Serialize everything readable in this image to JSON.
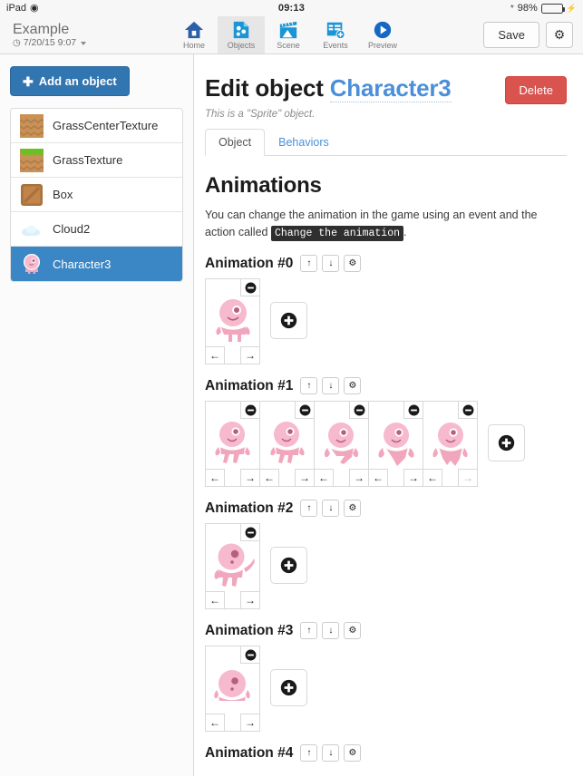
{
  "statusbar": {
    "device": "iPad",
    "wifi_icon": "wifi-icon",
    "time": "09:13",
    "bluetooth_icon": "bluetooth-icon",
    "battery_percent": "98%",
    "battery_icon": "battery-icon",
    "charging_icon": "lightning-bolt-icon"
  },
  "topbar": {
    "project_title": "Example",
    "project_date": "7/20/15 9:07",
    "clock_icon": "clock-icon",
    "caret_icon": "chevron-down-icon",
    "nav": [
      {
        "label": "Home",
        "icon": "home-icon",
        "active": false
      },
      {
        "label": "Objects",
        "icon": "objects-icon",
        "active": true
      },
      {
        "label": "Scene",
        "icon": "scene-icon",
        "active": false
      },
      {
        "label": "Events",
        "icon": "events-icon",
        "active": false
      },
      {
        "label": "Preview",
        "icon": "preview-icon",
        "active": false
      }
    ],
    "save_label": "Save",
    "settings_icon": "gear-icon"
  },
  "sidebar": {
    "add_object_label": "Add an object",
    "add_icon": "plus-icon",
    "objects": [
      {
        "name": "GrassCenterTexture",
        "thumb": "grass-center-texture-thumb",
        "selected": false
      },
      {
        "name": "GrassTexture",
        "thumb": "grass-texture-thumb",
        "selected": false
      },
      {
        "name": "Box",
        "thumb": "box-thumb",
        "selected": false
      },
      {
        "name": "Cloud2",
        "thumb": "cloud-thumb",
        "selected": false
      },
      {
        "name": "Character3",
        "thumb": "character-thumb",
        "selected": true
      }
    ]
  },
  "main": {
    "edit_prefix": "Edit object ",
    "object_name": "Character3",
    "delete_label": "Delete",
    "subtitle": "This is a \"Sprite\" object.",
    "tabs": [
      {
        "label": "Object",
        "active": true
      },
      {
        "label": "Behaviors",
        "active": false
      }
    ],
    "animations_heading": "Animations",
    "description_part1": "You can change the animation in the game using an event and the action called ",
    "description_code": "Change the animation",
    "description_part2": ".",
    "row_controls": {
      "move_up_icon": "arrow-up-icon",
      "move_down_icon": "arrow-down-icon",
      "settings_icon": "gear-icon"
    },
    "frame_controls": {
      "delete_icon": "minus-circle-icon",
      "prev_icon": "arrow-left-icon",
      "next_icon": "arrow-right-icon",
      "add_icon": "plus-circle-icon"
    },
    "animations": [
      {
        "title": "Animation #0",
        "frames": [
          {
            "pose": "idle"
          }
        ]
      },
      {
        "title": "Animation #1",
        "frames": [
          {
            "pose": "walk1"
          },
          {
            "pose": "walk2"
          },
          {
            "pose": "walk3"
          },
          {
            "pose": "walk4"
          },
          {
            "pose": "walk5"
          }
        ]
      },
      {
        "title": "Animation #2",
        "frames": [
          {
            "pose": "jump"
          }
        ]
      },
      {
        "title": "Animation #3",
        "frames": [
          {
            "pose": "crouch"
          }
        ]
      },
      {
        "title": "Animation #4",
        "frames": []
      }
    ]
  },
  "colors": {
    "accent_blue": "#3276b1",
    "selected_blue": "#3b86c4",
    "link_blue": "#4a90d9",
    "danger_red": "#d9534f",
    "sprite_pink": "#f2a6bd",
    "battery_green": "#4cd964"
  }
}
